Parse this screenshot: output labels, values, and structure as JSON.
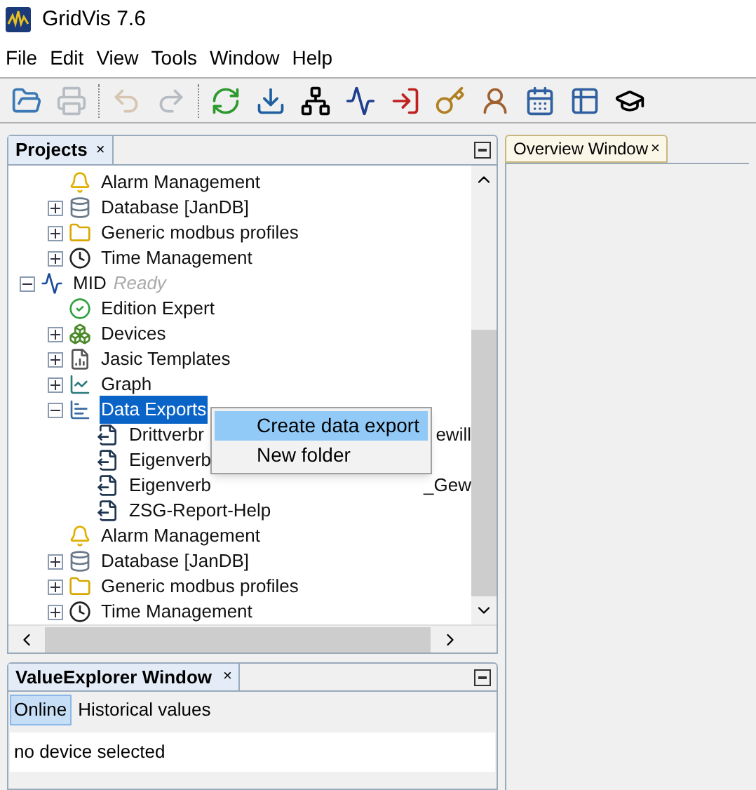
{
  "window": {
    "title": "GridVis 7.6"
  },
  "menu": [
    "File",
    "Edit",
    "View",
    "Tools",
    "Window",
    "Help"
  ],
  "toolbar": [
    {
      "kind": "open",
      "disabled": false
    },
    {
      "kind": "print",
      "disabled": true
    },
    {
      "kind": "sep"
    },
    {
      "kind": "undo",
      "disabled": true
    },
    {
      "kind": "redo",
      "disabled": true
    },
    {
      "kind": "sep"
    },
    {
      "kind": "sync",
      "disabled": false
    },
    {
      "kind": "download",
      "disabled": false
    },
    {
      "kind": "network",
      "disabled": false
    },
    {
      "kind": "chart",
      "disabled": false
    },
    {
      "kind": "import",
      "disabled": false
    },
    {
      "kind": "key",
      "disabled": false
    },
    {
      "kind": "user",
      "disabled": false
    },
    {
      "kind": "calendar",
      "disabled": false
    },
    {
      "kind": "table",
      "disabled": false
    },
    {
      "kind": "cap",
      "disabled": false
    }
  ],
  "projects_panel": {
    "tab": "Projects",
    "close": "×",
    "tree": [
      {
        "children": [
          {
            "label": "Alarm Management",
            "kind": "alarm"
          },
          {
            "label": "Database [JanDB]",
            "kind": "database",
            "expanded": false
          },
          {
            "label": "Generic modbus profiles",
            "kind": "folder",
            "expanded": false
          },
          {
            "label": "Time Management",
            "kind": "time",
            "expanded": false
          }
        ]
      },
      {
        "label": "MID",
        "status": "Ready",
        "kind": "project",
        "expanded": true,
        "children": [
          {
            "label": "Edition Expert",
            "kind": "edition"
          },
          {
            "label": "Devices",
            "kind": "devices",
            "expanded": false
          },
          {
            "label": "Jasic Templates",
            "kind": "jasic",
            "expanded": false
          },
          {
            "label": "Graph",
            "kind": "graph",
            "expanded": false
          },
          {
            "label": "Data Exports",
            "kind": "exports",
            "expanded": true,
            "selected": true,
            "children": [
              {
                "label": "Drittverbr",
                "tail": "ewill",
                "kind": "export",
                "selected": false
              },
              {
                "label": "Eigenverb",
                "kind": "export",
                "selected": false
              },
              {
                "label": "Eigenverb",
                "tail": "_Gew",
                "kind": "export",
                "selected": false
              },
              {
                "label": "ZSG-Report-Help",
                "kind": "export",
                "selected": false
              }
            ]
          },
          {
            "label": "Alarm Management",
            "kind": "alarm",
            "selected": false
          },
          {
            "label": "Database [JanDB]",
            "kind": "database",
            "expanded": false,
            "selected": false
          },
          {
            "label": "Generic modbus profiles",
            "kind": "folder",
            "expanded": false,
            "selected": false
          },
          {
            "label": "Time Management",
            "kind": "time",
            "expanded": false,
            "selected": false
          }
        ]
      }
    ]
  },
  "context_menu": [
    {
      "label": "Create data export",
      "selected": true
    },
    {
      "label": "New folder",
      "selected": false
    }
  ],
  "overview_panel": {
    "tab": "Overview Window",
    "close": "×"
  },
  "value_explorer": {
    "tab": "ValueExplorer Window",
    "close": "×",
    "modes": [
      {
        "label": "Online",
        "selected": true
      },
      {
        "label": "Historical values",
        "selected": false
      }
    ],
    "message": "no device selected"
  }
}
